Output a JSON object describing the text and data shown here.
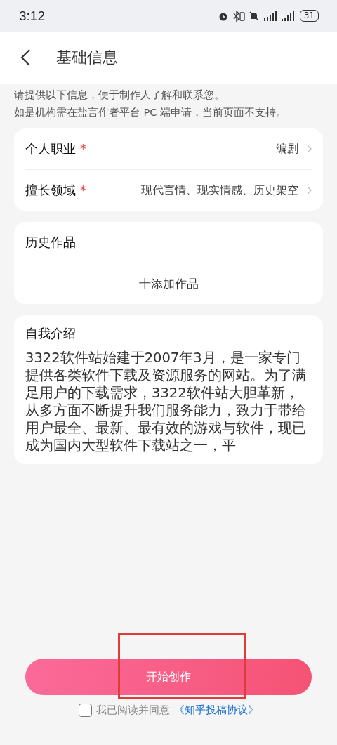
{
  "status_bar": {
    "time": "3:12",
    "battery": "31"
  },
  "header": {
    "title": "基础信息"
  },
  "notice": [
    "请提供以下信息，便于制作人了解和联系您。",
    "如是机构需在盐言作者平台 PC 端申请，当前页面不支持。"
  ],
  "fields": [
    {
      "label": "个人职业",
      "required_mark": "*",
      "value": "编剧"
    },
    {
      "label": "擅长领域",
      "required_mark": "*",
      "value": "现代言情、现实情感、历史架空"
    }
  ],
  "works": {
    "title": "历史作品",
    "add_button": "十添加作品"
  },
  "intro": {
    "title": "自我介绍",
    "text": "3322软件站始建于2007年3月，是一家专门提供各类软件下载及资源服务的网站。为了满足用户的下载需求，3322软件站大胆革新，从多方面不断提升我们服务能力，致力于带给用户最全、最新、最有效的游戏与软件，现已成为国内大型软件下载站之一，平"
  },
  "start_button": "开始创作",
  "agreement": {
    "checked": false,
    "text": "我已阅读并同意",
    "link": "《知乎投稿协议》"
  }
}
